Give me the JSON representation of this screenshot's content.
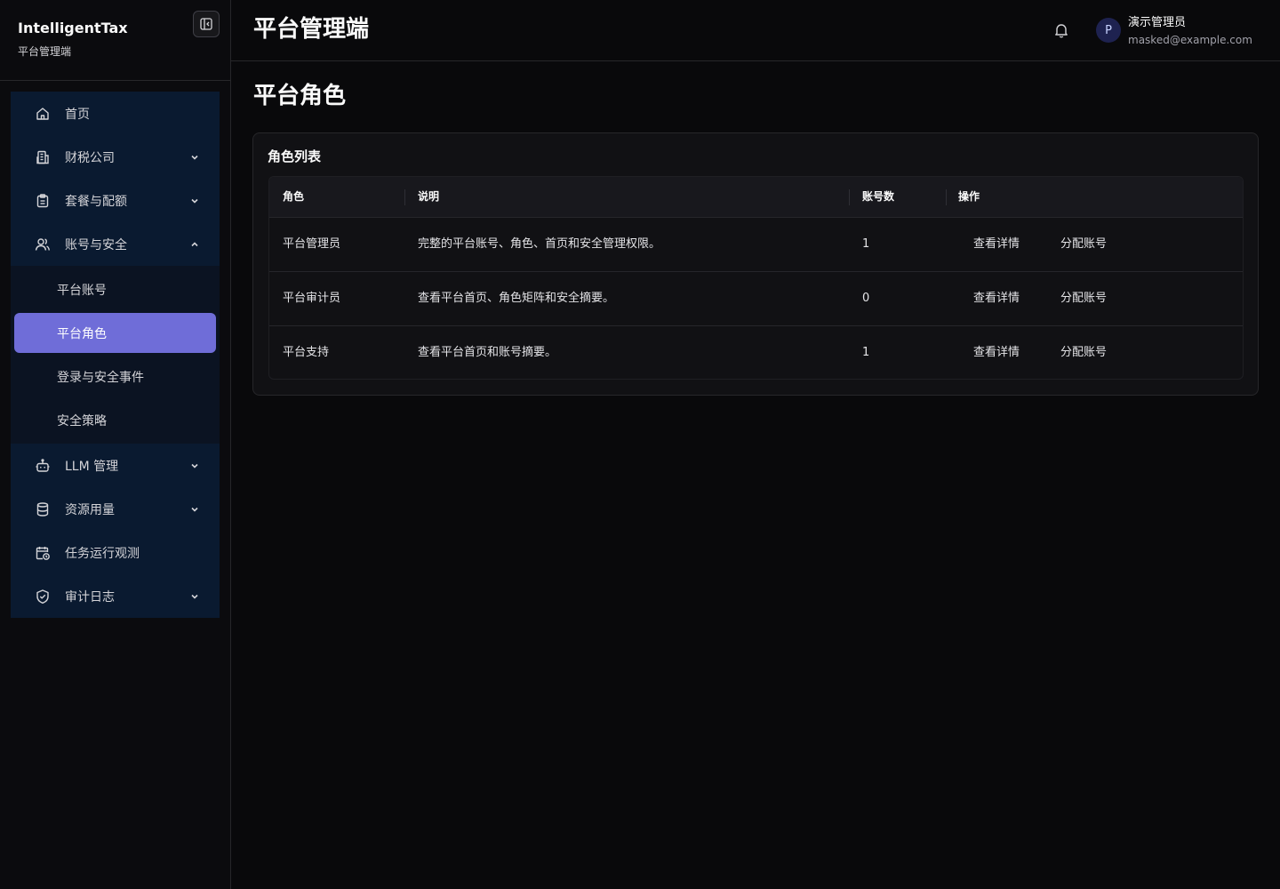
{
  "brand": {
    "name": "IntelligentTax",
    "subtitle": "平台管理端"
  },
  "header": {
    "title": "平台管理端",
    "user_name": "演示管理员",
    "user_email": "masked@example.com",
    "avatar_letter": "P"
  },
  "nav": {
    "items": [
      {
        "label": "首页",
        "icon": "home-icon"
      },
      {
        "label": "财税公司",
        "icon": "building-icon"
      },
      {
        "label": "套餐与配额",
        "icon": "clipboard-icon"
      },
      {
        "label": "账号与安全",
        "icon": "users-icon"
      }
    ],
    "sub_items": [
      {
        "label": "平台账号"
      },
      {
        "label": "平台角色",
        "active": true
      },
      {
        "label": "登录与安全事件"
      },
      {
        "label": "安全策略"
      }
    ],
    "items_after": [
      {
        "label": "LLM 管理",
        "icon": "bot-icon"
      },
      {
        "label": "资源用量",
        "icon": "database-icon"
      },
      {
        "label": "任务运行观测",
        "icon": "calendar-clock-icon"
      },
      {
        "label": "审计日志",
        "icon": "shield-check-icon"
      }
    ]
  },
  "page": {
    "title": "平台角色"
  },
  "card": {
    "title": "角色列表"
  },
  "table": {
    "headers": [
      "角色",
      "说明",
      "账号数",
      "操作"
    ],
    "rows": [
      {
        "role": "平台管理员",
        "desc": "完整的平台账号、角色、首页和安全管理权限。",
        "count": "1",
        "view": "查看详情",
        "assign": "分配账号"
      },
      {
        "role": "平台审计员",
        "desc": "查看平台首页、角色矩阵和安全摘要。",
        "count": "0",
        "view": "查看详情",
        "assign": "分配账号"
      },
      {
        "role": "平台支持",
        "desc": "查看平台首页和账号摘要。",
        "count": "1",
        "view": "查看详情",
        "assign": "分配账号"
      }
    ]
  },
  "colors": {
    "accent": "#6f6dd8",
    "nav_bg": "#0a1a30",
    "background": "#09090b"
  }
}
